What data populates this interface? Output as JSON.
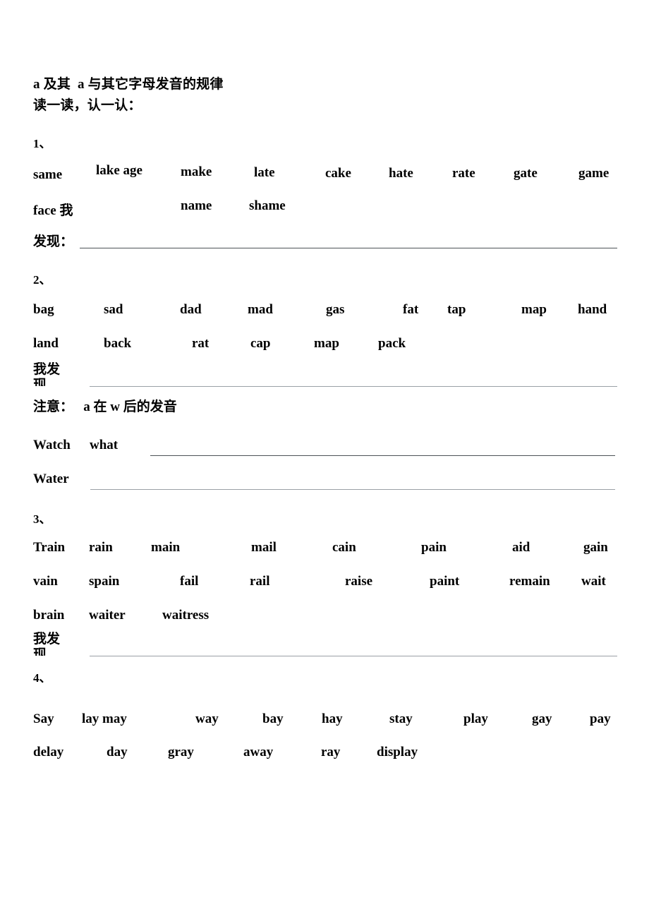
{
  "document": {
    "title": "a 及其  a 与其它字母发音的规律",
    "subtitle": "读一读，认一认："
  },
  "labels": {
    "finding_prefix": "发现：",
    "finding_full": "我发现",
    "note": "注意：   a 在 w 后的发音"
  },
  "sections": [
    {
      "number": "1、",
      "rows": [
        [
          "same",
          "lake age",
          "make",
          "late",
          "cake",
          "hate",
          "rate",
          "gate",
          "game"
        ],
        [
          "face 我",
          "name",
          "shame"
        ]
      ],
      "answer_label": "发现："
    },
    {
      "number": "2、",
      "rows": [
        [
          "bag",
          "sad",
          "dad",
          "mad",
          "gas",
          "fat",
          "tap",
          "map",
          "hand"
        ],
        [
          "land",
          "back",
          "rat",
          "cap",
          "map",
          "pack"
        ]
      ],
      "answer_label": "我发现"
    },
    {
      "number": "3、",
      "rows": [
        [
          "Train",
          "rain",
          "main",
          "mail",
          "cain",
          "pain",
          "aid",
          "gain"
        ],
        [
          "vain",
          "spain",
          "fail",
          "rail",
          "raise",
          "paint",
          "remain",
          "wait"
        ],
        [
          "brain",
          "waiter",
          "waitress"
        ]
      ],
      "answer_label": "我发现"
    },
    {
      "number": "4、",
      "rows": [
        [
          "Say",
          "lay may",
          "way",
          "bay",
          "hay",
          "stay",
          "play",
          "gay",
          "pay"
        ],
        [
          "delay",
          "day",
          "gray",
          "away",
          "ray",
          "display"
        ]
      ],
      "answer_label": ""
    }
  ],
  "note_block": {
    "heading": "注意：   a 在 w 后的发音",
    "rows": [
      [
        "Watch",
        "what"
      ],
      [
        "Water"
      ]
    ]
  },
  "colors": {
    "text": "#000000",
    "rule_dark": "#4c5257",
    "rule_light": "#9aa0a6",
    "background": "#ffffff"
  }
}
